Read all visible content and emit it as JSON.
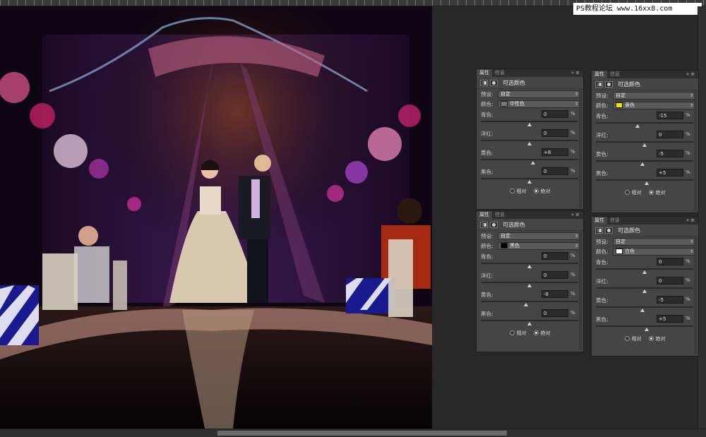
{
  "watermark": "PS教程论坛 www.16xx8.com",
  "panels": [
    {
      "tabs": [
        "属性",
        "信息"
      ],
      "title": "可选颜色",
      "preset_label": "预设:",
      "preset_value": "自定",
      "color_label": "颜色:",
      "color_value": "中性色",
      "swatch": "#7a7a7a",
      "sliders": [
        {
          "label": "青色:",
          "value": "0"
        },
        {
          "label": "洋红:",
          "value": "0"
        },
        {
          "label": "黄色:",
          "value": "+8"
        },
        {
          "label": "黑色:",
          "value": "0"
        }
      ],
      "relative_label": "相对",
      "absolute_label": "绝对",
      "mode": "absolute"
    },
    {
      "tabs": [
        "属性",
        "信息"
      ],
      "title": "可选颜色",
      "preset_label": "预设:",
      "preset_value": "自定",
      "color_label": "颜色:",
      "color_value": "黄色",
      "swatch": "#f5e000",
      "sliders": [
        {
          "label": "青色:",
          "value": "-15"
        },
        {
          "label": "洋红:",
          "value": "0"
        },
        {
          "label": "黄色:",
          "value": "-5"
        },
        {
          "label": "黑色:",
          "value": "+5"
        }
      ],
      "relative_label": "相对",
      "absolute_label": "绝对",
      "mode": "absolute"
    },
    {
      "tabs": [
        "属性",
        "信息"
      ],
      "title": "可选颜色",
      "preset_label": "预设:",
      "preset_value": "自定",
      "color_label": "颜色:",
      "color_value": "黑色",
      "swatch": "#000000",
      "sliders": [
        {
          "label": "青色:",
          "value": "0"
        },
        {
          "label": "洋红:",
          "value": "0"
        },
        {
          "label": "黄色:",
          "value": "-8"
        },
        {
          "label": "黑色:",
          "value": "0"
        }
      ],
      "relative_label": "相对",
      "absolute_label": "绝对",
      "mode": "absolute"
    },
    {
      "tabs": [
        "属性",
        "信息"
      ],
      "title": "可选颜色",
      "preset_label": "预设:",
      "preset_value": "自定",
      "color_label": "颜色:",
      "color_value": "白色",
      "swatch": "#ffffff",
      "sliders": [
        {
          "label": "青色:",
          "value": "0"
        },
        {
          "label": "洋红:",
          "value": "0"
        },
        {
          "label": "黄色:",
          "value": "-5"
        },
        {
          "label": "黑色:",
          "value": "+5"
        }
      ],
      "relative_label": "相对",
      "absolute_label": "绝对",
      "mode": "absolute"
    }
  ],
  "percent": "%"
}
